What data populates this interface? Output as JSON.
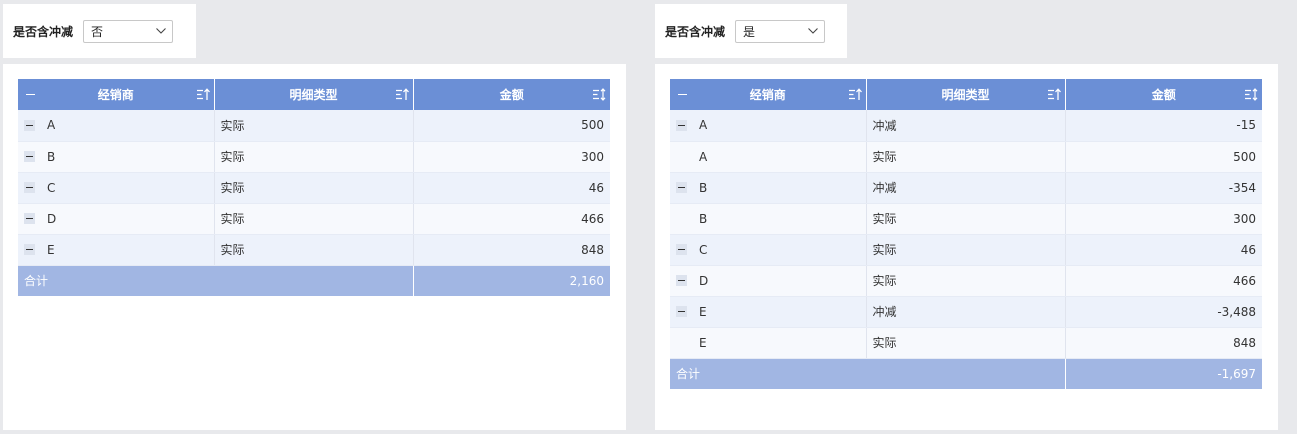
{
  "left": {
    "filter": {
      "label": "是否含冲减",
      "value": "否"
    },
    "headers": {
      "dealer": "经销商",
      "type": "明细类型",
      "amount": "金额"
    },
    "rows": [
      {
        "dealer": "A",
        "type": "实际",
        "amount": "500",
        "collapse": true
      },
      {
        "dealer": "B",
        "type": "实际",
        "amount": "300",
        "collapse": true
      },
      {
        "dealer": "C",
        "type": "实际",
        "amount": "46",
        "collapse": true
      },
      {
        "dealer": "D",
        "type": "实际",
        "amount": "466",
        "collapse": true
      },
      {
        "dealer": "E",
        "type": "实际",
        "amount": "848",
        "collapse": true
      }
    ],
    "total": {
      "label": "合计",
      "amount": "2,160"
    }
  },
  "right": {
    "filter": {
      "label": "是否含冲减",
      "value": "是"
    },
    "headers": {
      "dealer": "经销商",
      "type": "明细类型",
      "amount": "金额"
    },
    "rows": [
      {
        "dealer": "A",
        "type": "冲减",
        "amount": "-15",
        "collapse": true
      },
      {
        "dealer": "A",
        "type": "实际",
        "amount": "500",
        "collapse": false
      },
      {
        "dealer": "B",
        "type": "冲减",
        "amount": "-354",
        "collapse": true
      },
      {
        "dealer": "B",
        "type": "实际",
        "amount": "300",
        "collapse": false
      },
      {
        "dealer": "C",
        "type": "实际",
        "amount": "46",
        "collapse": true
      },
      {
        "dealer": "D",
        "type": "实际",
        "amount": "466",
        "collapse": true
      },
      {
        "dealer": "E",
        "type": "冲减",
        "amount": "-3,488",
        "collapse": true
      },
      {
        "dealer": "E",
        "type": "实际",
        "amount": "848",
        "collapse": false
      }
    ],
    "total": {
      "label": "合计",
      "amount": "-1,697"
    }
  },
  "icons": {
    "sort_asc": "sort-ascending-icon",
    "sort_both": "sort-toggle-icon",
    "collapse": "collapse-minus-icon",
    "dropdown": "chevron-down-icon"
  },
  "colors": {
    "header": "#6b8fd6",
    "total_row": "#a1b6e3",
    "row_odd": "#edf2fb",
    "row_even": "#f7f9fd",
    "background": "#e8e9ec"
  }
}
